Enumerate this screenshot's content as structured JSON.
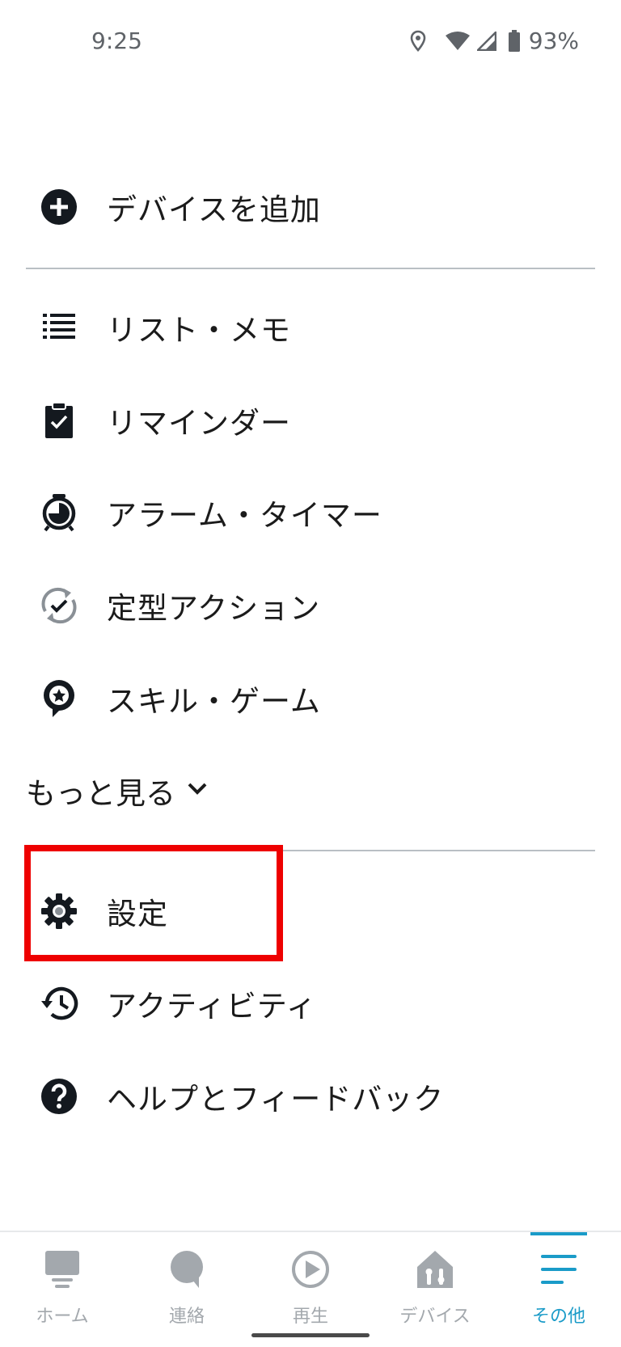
{
  "status_bar": {
    "time": "9:25",
    "battery": "93%"
  },
  "menu": {
    "add_device": {
      "label": "デバイスを追加",
      "icon": "plus-circle-icon"
    },
    "items": [
      {
        "label": "リスト・メモ",
        "icon": "list-icon"
      },
      {
        "label": "リマインダー",
        "icon": "clipboard-check-icon"
      },
      {
        "label": "アラーム・タイマー",
        "icon": "alarm-clock-icon"
      },
      {
        "label": "定型アクション",
        "icon": "routine-icon"
      },
      {
        "label": "スキル・ゲーム",
        "icon": "skill-star-icon"
      }
    ],
    "more_label": "もっと見る",
    "settings": [
      {
        "label": "設定",
        "icon": "gear-icon",
        "highlighted": true
      },
      {
        "label": "アクティビティ",
        "icon": "history-icon"
      },
      {
        "label": "ヘルプとフィードバック",
        "icon": "help-icon"
      }
    ]
  },
  "bottom_nav": {
    "items": [
      {
        "label": "ホーム",
        "icon": "home-icon"
      },
      {
        "label": "連絡",
        "icon": "chat-icon"
      },
      {
        "label": "再生",
        "icon": "play-icon"
      },
      {
        "label": "デバイス",
        "icon": "devices-icon"
      },
      {
        "label": "その他",
        "icon": "menu-icon",
        "active": true
      }
    ]
  },
  "colors": {
    "accent": "#1a9bc8",
    "highlight_border": "#ee0000",
    "inactive_nav": "#a3a8ad",
    "text": "#1b1b1b"
  }
}
